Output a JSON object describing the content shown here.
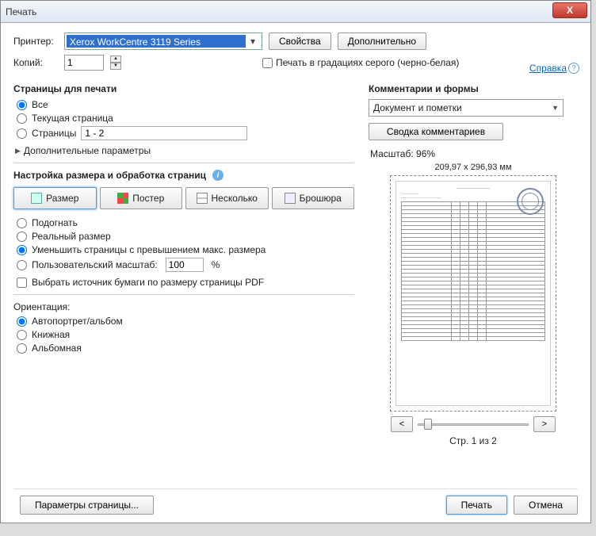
{
  "window_title": "Печать",
  "close_icon": "X",
  "printer": {
    "label": "Принтер:",
    "value": "Xerox WorkCentre 3119 Series"
  },
  "buttons": {
    "properties": "Свойства",
    "advanced": "Дополнительно",
    "summary": "Сводка комментариев",
    "page_setup": "Параметры страницы...",
    "print": "Печать",
    "cancel": "Отмена"
  },
  "help": {
    "link": "Справка",
    "icon": "?"
  },
  "copies": {
    "label": "Копий:",
    "value": "1"
  },
  "grayscale": {
    "label": "Печать в градациях серого (черно-белая)"
  },
  "pages": {
    "title": "Страницы для печати",
    "all": "Все",
    "current": "Текущая страница",
    "range_label": "Страницы",
    "range_value": "1 - 2",
    "more": "Дополнительные параметры"
  },
  "sizing": {
    "title": "Настройка размера и обработка страниц",
    "info": "i",
    "size": "Размер",
    "poster": "Постер",
    "multiple": "Несколько",
    "booklet": "Брошюра",
    "fit": "Подогнать",
    "actual": "Реальный размер",
    "shrink": "Уменьшить страницы с превышением макс. размера",
    "custom": "Пользовательский масштаб:",
    "custom_value": "100",
    "pct": "%",
    "source": "Выбрать источник бумаги по размеру страницы PDF"
  },
  "orientation": {
    "title": "Ориентация:",
    "auto": "Автопортрет/альбом",
    "portrait": "Книжная",
    "landscape": "Альбомная"
  },
  "comments": {
    "title": "Комментарии и формы",
    "dropdown": "Документ и пометки"
  },
  "preview": {
    "scale_label": "Масштаб:",
    "scale_value": "96%",
    "dimensions": "209,97 x 296,93 мм",
    "nav_prev": "<",
    "nav_next": ">",
    "page_of": "Стр. 1 из 2"
  }
}
